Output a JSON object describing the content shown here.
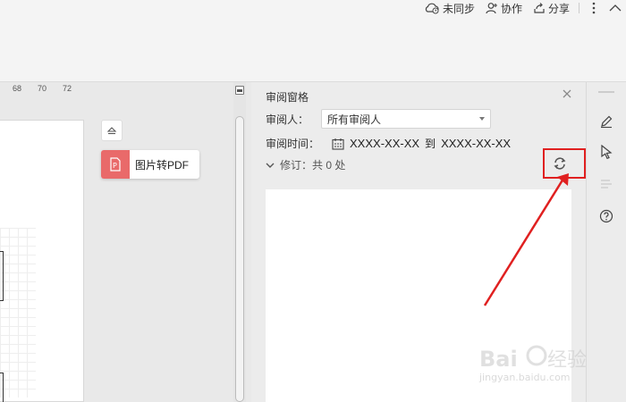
{
  "top": {
    "sync_label": "未同步",
    "collab_label": "协作",
    "share_label": "分享"
  },
  "ruler": {
    "ticks": [
      "68",
      "70",
      "72"
    ]
  },
  "canvas": {
    "img2pdf_label": "图片转PDF"
  },
  "review": {
    "title": "审阅窗格",
    "reviewer_label": "审阅人：",
    "reviewer_value": "所有审阅人",
    "time_label": "审阅时间：",
    "date_from": "XXXX-XX-XX",
    "date_to_word": "到",
    "date_to": "XXXX-XX-XX",
    "revisions_label": "修订：共 0 处"
  },
  "watermark": {
    "text": "jingyan.baidu.com"
  },
  "colors": {
    "accent_red": "#e02020",
    "pdf_icon_bg": "#e96a6a"
  }
}
